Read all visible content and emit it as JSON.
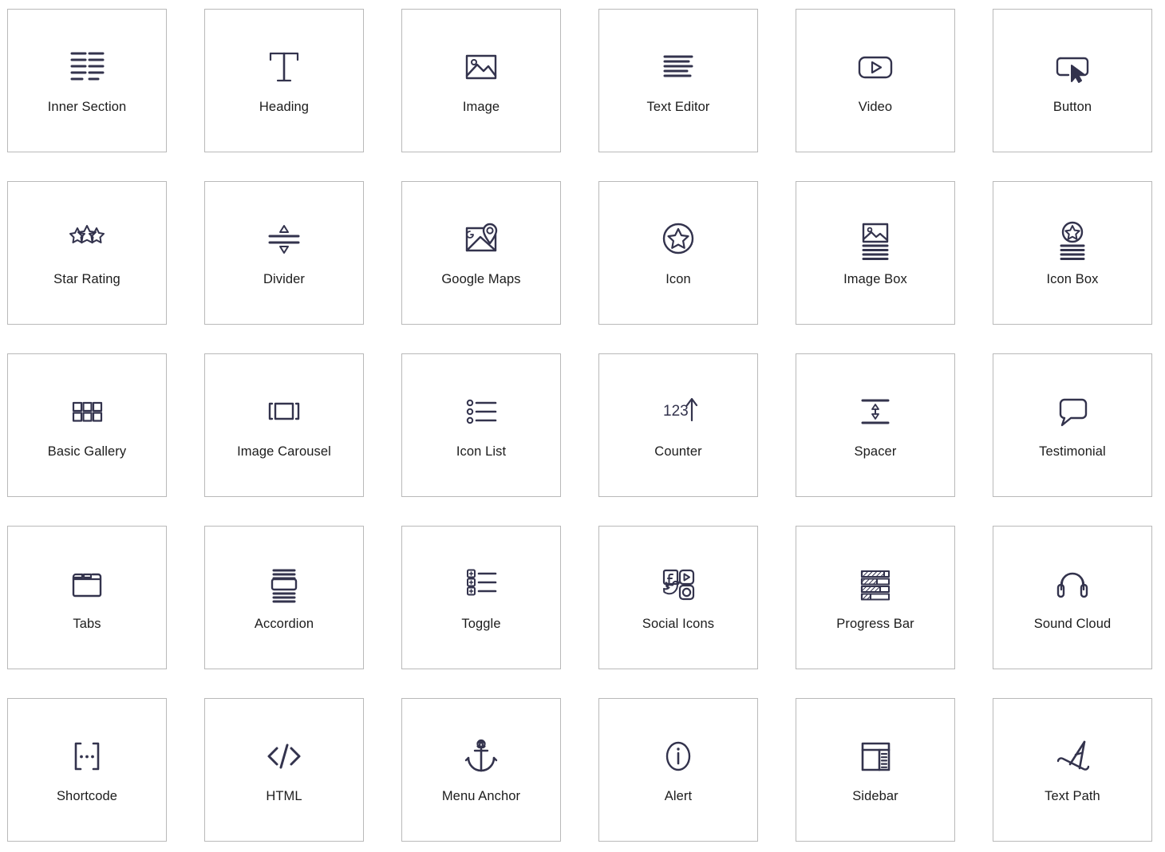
{
  "panel": {
    "name": "elements-panel",
    "columns": 6,
    "rows": 5,
    "colors": {
      "background": "#ffffff",
      "card_border": "#b9b9b9",
      "icon_stroke": "#33334d",
      "label_text": "#1c1c1c"
    }
  },
  "widgets": [
    {
      "label": "Inner Section",
      "icon": "inner-section-icon"
    },
    {
      "label": "Heading",
      "icon": "heading-icon"
    },
    {
      "label": "Image",
      "icon": "image-icon"
    },
    {
      "label": "Text Editor",
      "icon": "text-editor-icon"
    },
    {
      "label": "Video",
      "icon": "video-play-icon"
    },
    {
      "label": "Button",
      "icon": "button-cursor-icon"
    },
    {
      "label": "Star Rating",
      "icon": "star-rating-icon"
    },
    {
      "label": "Divider",
      "icon": "divider-icon"
    },
    {
      "label": "Google Maps",
      "icon": "google-maps-icon"
    },
    {
      "label": "Icon",
      "icon": "star-circle-icon"
    },
    {
      "label": "Image Box",
      "icon": "image-box-icon"
    },
    {
      "label": "Icon Box",
      "icon": "icon-box-icon"
    },
    {
      "label": "Basic Gallery",
      "icon": "basic-gallery-icon"
    },
    {
      "label": "Image Carousel",
      "icon": "image-carousel-icon"
    },
    {
      "label": "Icon List",
      "icon": "icon-list-icon"
    },
    {
      "label": "Counter",
      "icon": "counter-123-icon"
    },
    {
      "label": "Spacer",
      "icon": "spacer-icon"
    },
    {
      "label": "Testimonial",
      "icon": "testimonial-quote-icon"
    },
    {
      "label": "Tabs",
      "icon": "tabs-folder-icon"
    },
    {
      "label": "Accordion",
      "icon": "accordion-icon"
    },
    {
      "label": "Toggle",
      "icon": "toggle-plus-list-icon"
    },
    {
      "label": "Social Icons",
      "icon": "social-icons-icon"
    },
    {
      "label": "Progress Bar",
      "icon": "progress-bar-icon"
    },
    {
      "label": "Sound Cloud",
      "icon": "headphones-icon"
    },
    {
      "label": "Shortcode",
      "icon": "shortcode-brackets-icon"
    },
    {
      "label": "HTML",
      "icon": "html-code-icon"
    },
    {
      "label": "Menu Anchor",
      "icon": "anchor-icon"
    },
    {
      "label": "Alert",
      "icon": "info-circle-icon"
    },
    {
      "label": "Sidebar",
      "icon": "sidebar-layout-icon"
    },
    {
      "label": "Text Path",
      "icon": "text-path-icon"
    }
  ]
}
